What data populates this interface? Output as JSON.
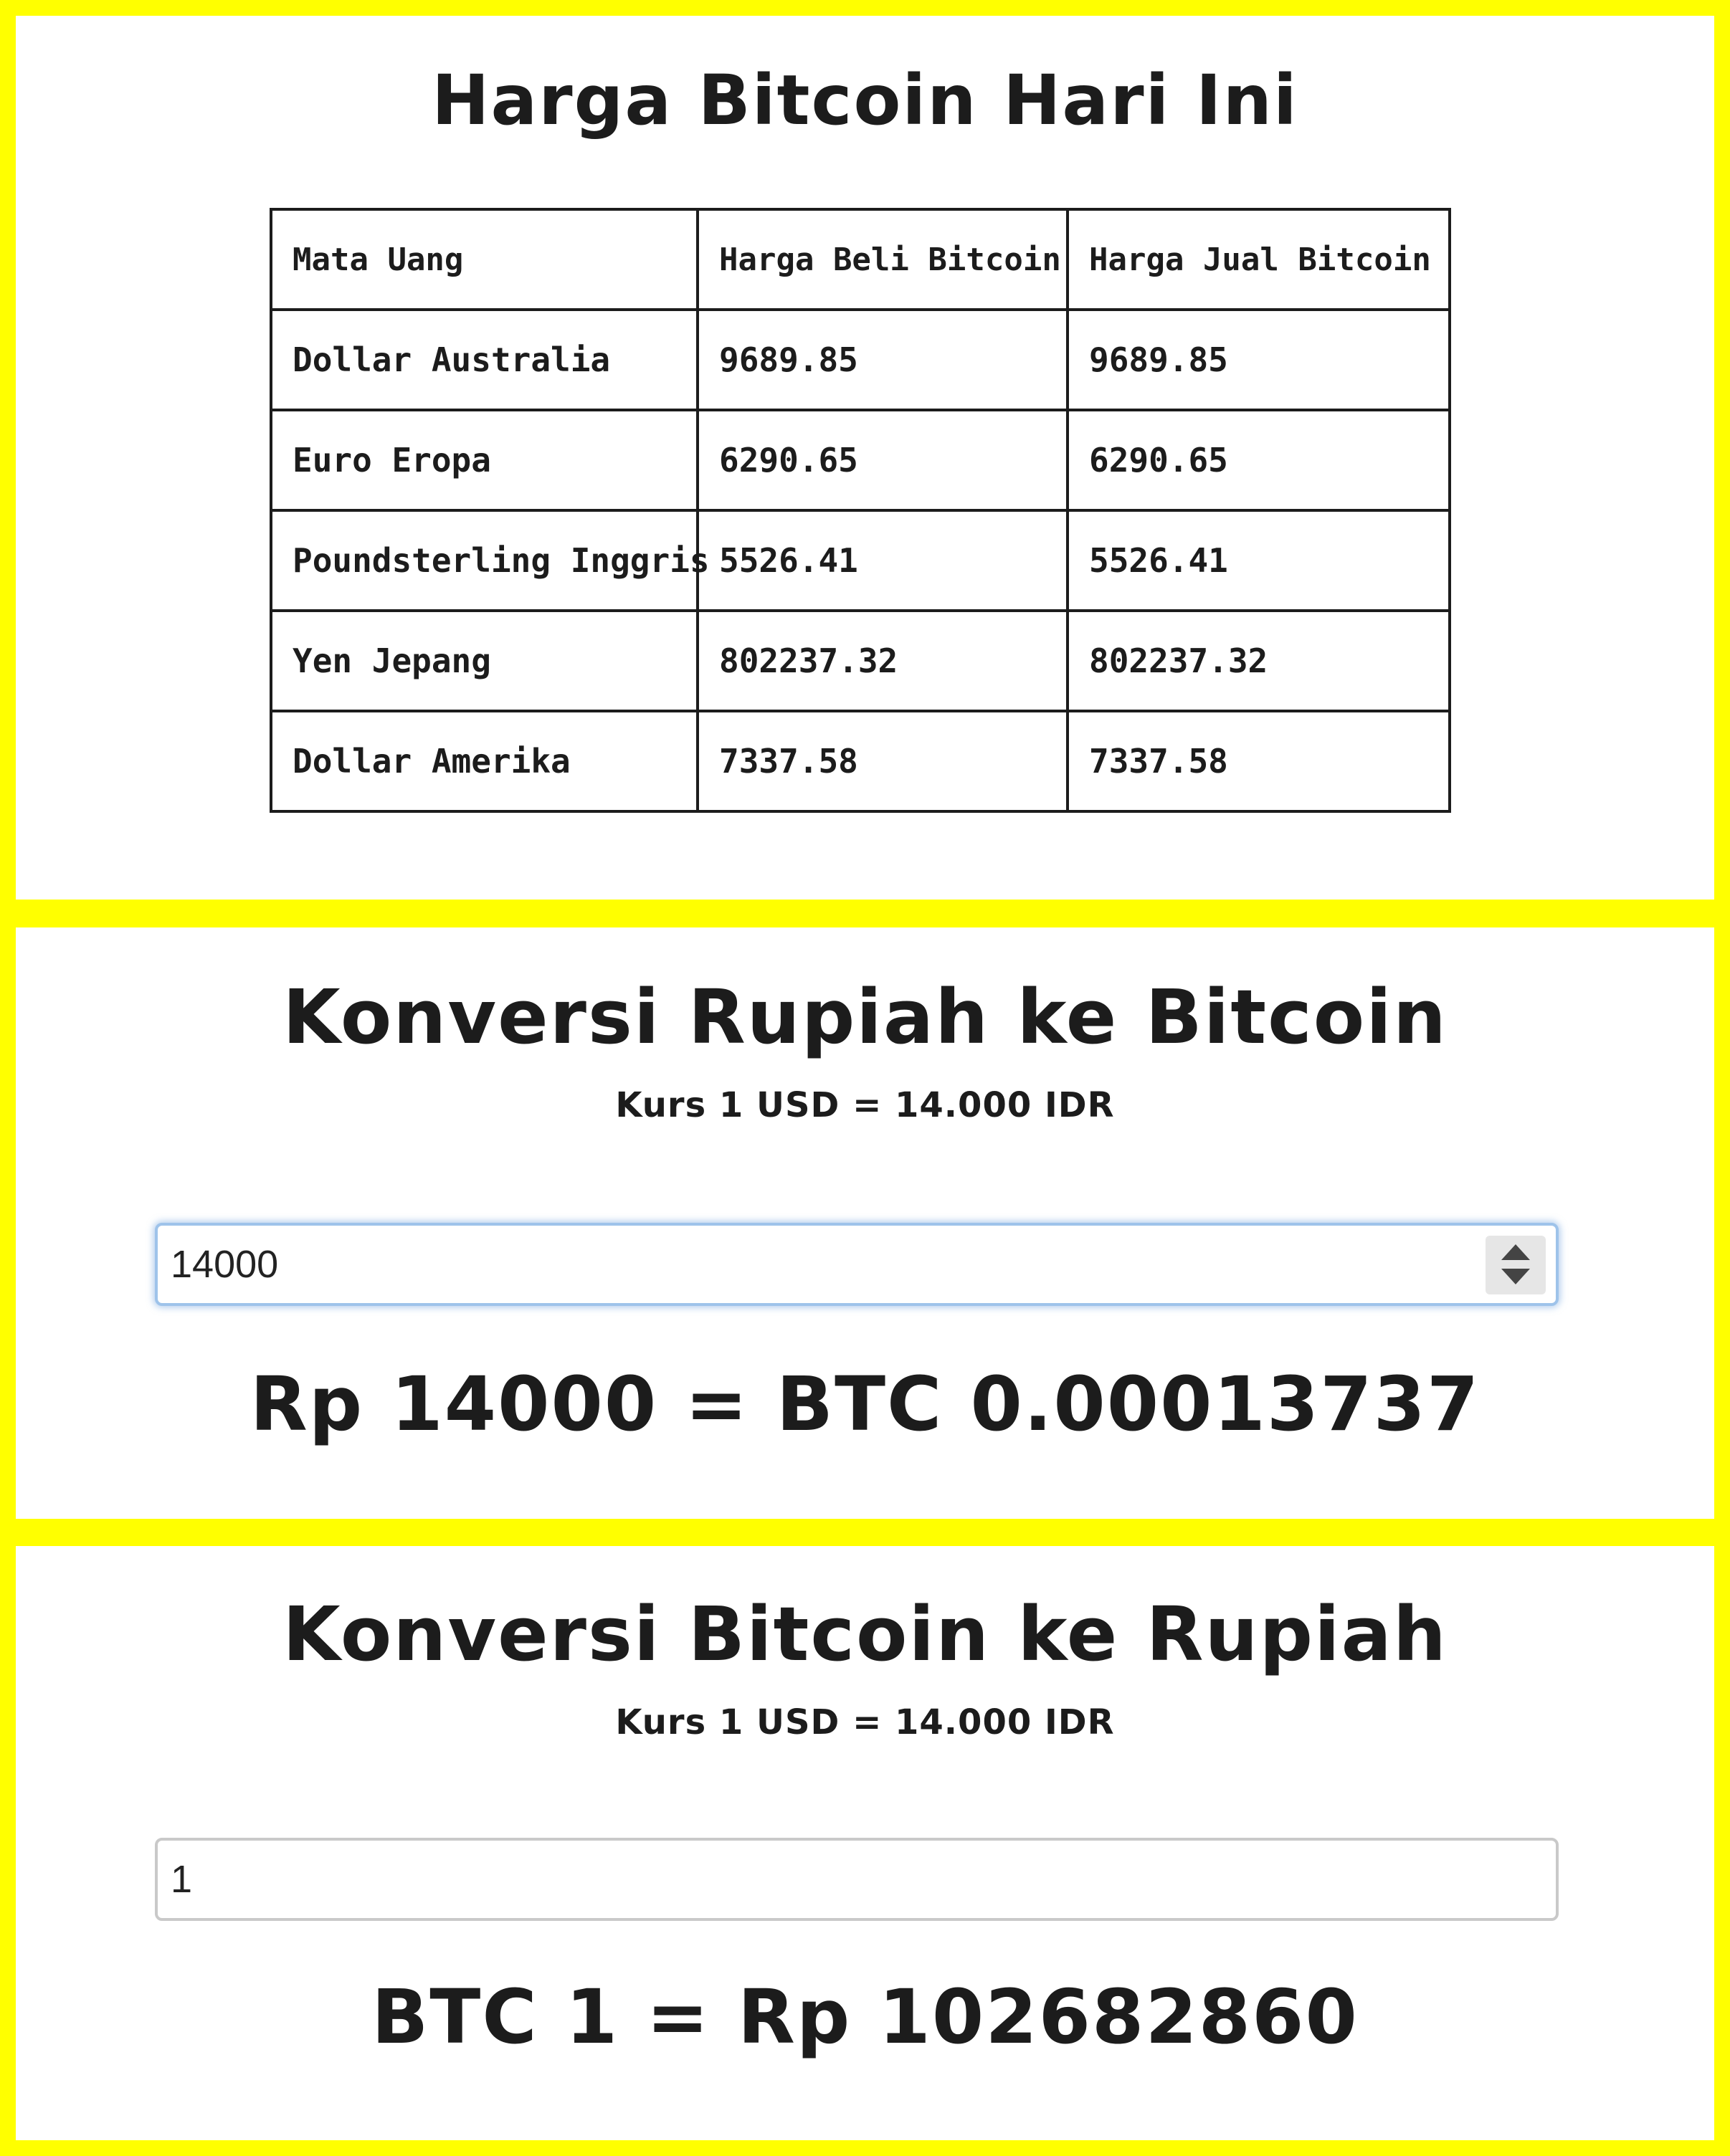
{
  "prices_section": {
    "title": "Harga Bitcoin Hari Ini",
    "columns": [
      "Mata Uang",
      "Harga Beli Bitcoin",
      "Harga Jual Bitcoin"
    ],
    "rows": [
      [
        "Dollar Australia",
        "9689.85",
        "9689.85"
      ],
      [
        "Euro Eropa",
        "6290.65",
        "6290.65"
      ],
      [
        "Poundsterling Inggris",
        "5526.41",
        "5526.41"
      ],
      [
        "Yen Jepang",
        "802237.32",
        "802237.32"
      ],
      [
        "Dollar Amerika",
        "7337.58",
        "7337.58"
      ]
    ]
  },
  "idr_to_btc": {
    "title": "Konversi Rupiah ke Bitcoin",
    "rate": "Kurs 1 USD = 14.000 IDR",
    "input_value": "14000",
    "result": "Rp 14000 = BTC 0.00013737"
  },
  "btc_to_idr": {
    "title": "Konversi Bitcoin ke Rupiah",
    "rate": "Kurs 1 USD = 14.000 IDR",
    "input_value": "1",
    "result": "BTC 1 = Rp 102682860"
  },
  "colors": {
    "frame": "#ffff00",
    "panel": "#ffffff",
    "text": "#1c1c1c",
    "focus_ring": "#9ec3ea"
  },
  "icons": {
    "stepper": "spinner-arrows-icon"
  }
}
